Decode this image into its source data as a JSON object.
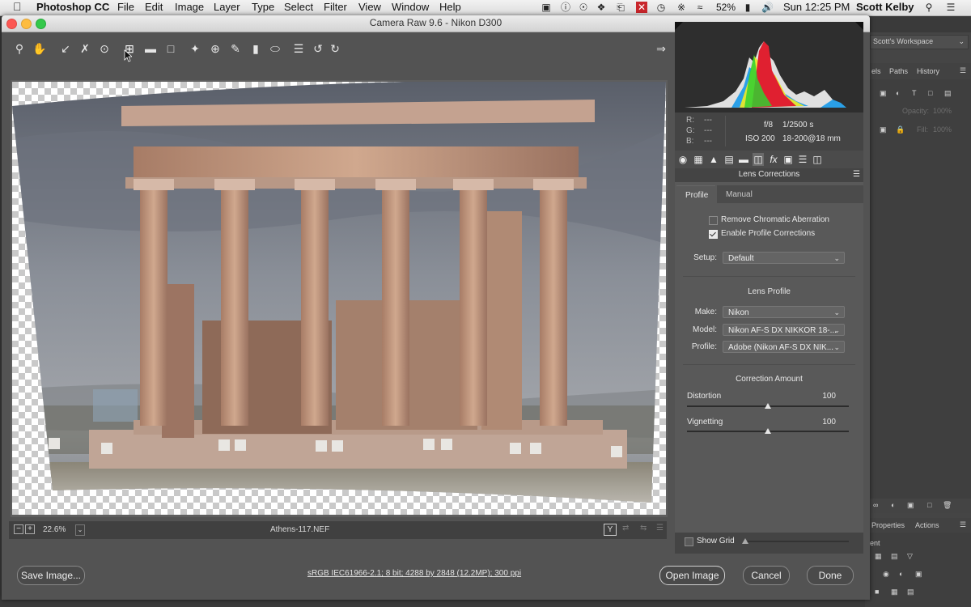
{
  "menubar": {
    "app_name": "Photoshop CC",
    "menus": [
      "File",
      "Edit",
      "Image",
      "Layer",
      "Type",
      "Select",
      "Filter",
      "View",
      "Window",
      "Help"
    ],
    "battery": "52%",
    "clock": "Sun 12:25 PM",
    "user": "Scott Kelby"
  },
  "window": {
    "title": "Camera Raw 9.6  -  Nikon D300"
  },
  "right_ps": {
    "workspace": "Scott's Workspace",
    "tabs": [
      "els",
      "Paths",
      "History"
    ],
    "opacity_label": "Opacity:",
    "opacity_value": "100%",
    "fill_label": "Fill:",
    "fill_value": "100%",
    "bottom_tabs": [
      "Properties",
      "Actions"
    ],
    "bottom_frag": "ent"
  },
  "info": {
    "r_label": "R:",
    "g_label": "G:",
    "b_label": "B:",
    "rgb_value": "---",
    "aperture": "f/8",
    "shutter": "1/2500 s",
    "iso": "ISO 200",
    "lens": "18-200@18 mm"
  },
  "panel": {
    "title": "Lens Corrections",
    "tabs": [
      "Profile",
      "Manual"
    ],
    "remove_ca_label": "Remove Chromatic Aberration",
    "enable_profile_label": "Enable Profile Corrections",
    "setup_label": "Setup:",
    "setup_value": "Default",
    "lens_profile_heading": "Lens Profile",
    "make_label": "Make:",
    "make_value": "Nikon",
    "model_label": "Model:",
    "model_value": "Nikon AF-S DX NIKKOR 18-...",
    "profile_label": "Profile:",
    "profile_value": "Adobe (Nikon AF-S DX NIK...",
    "correction_heading": "Correction Amount",
    "distortion_label": "Distortion",
    "distortion_value": 100,
    "distortion_max": 200,
    "vignetting_label": "Vignetting",
    "vignetting_value": 100,
    "vignetting_max": 200,
    "show_grid_label": "Show Grid",
    "remove_ca_checked": false,
    "enable_profile_checked": true
  },
  "bottom": {
    "zoom": "22.6%",
    "filename": "Athens-117.NEF",
    "workflow": "sRGB IEC61966-2.1; 8 bit; 4288 by 2848 (12.2MP); 300 ppi",
    "save_button": "Save Image...",
    "open_button": "Open Image",
    "cancel_button": "Cancel",
    "done_button": "Done",
    "y_label": "Y"
  }
}
